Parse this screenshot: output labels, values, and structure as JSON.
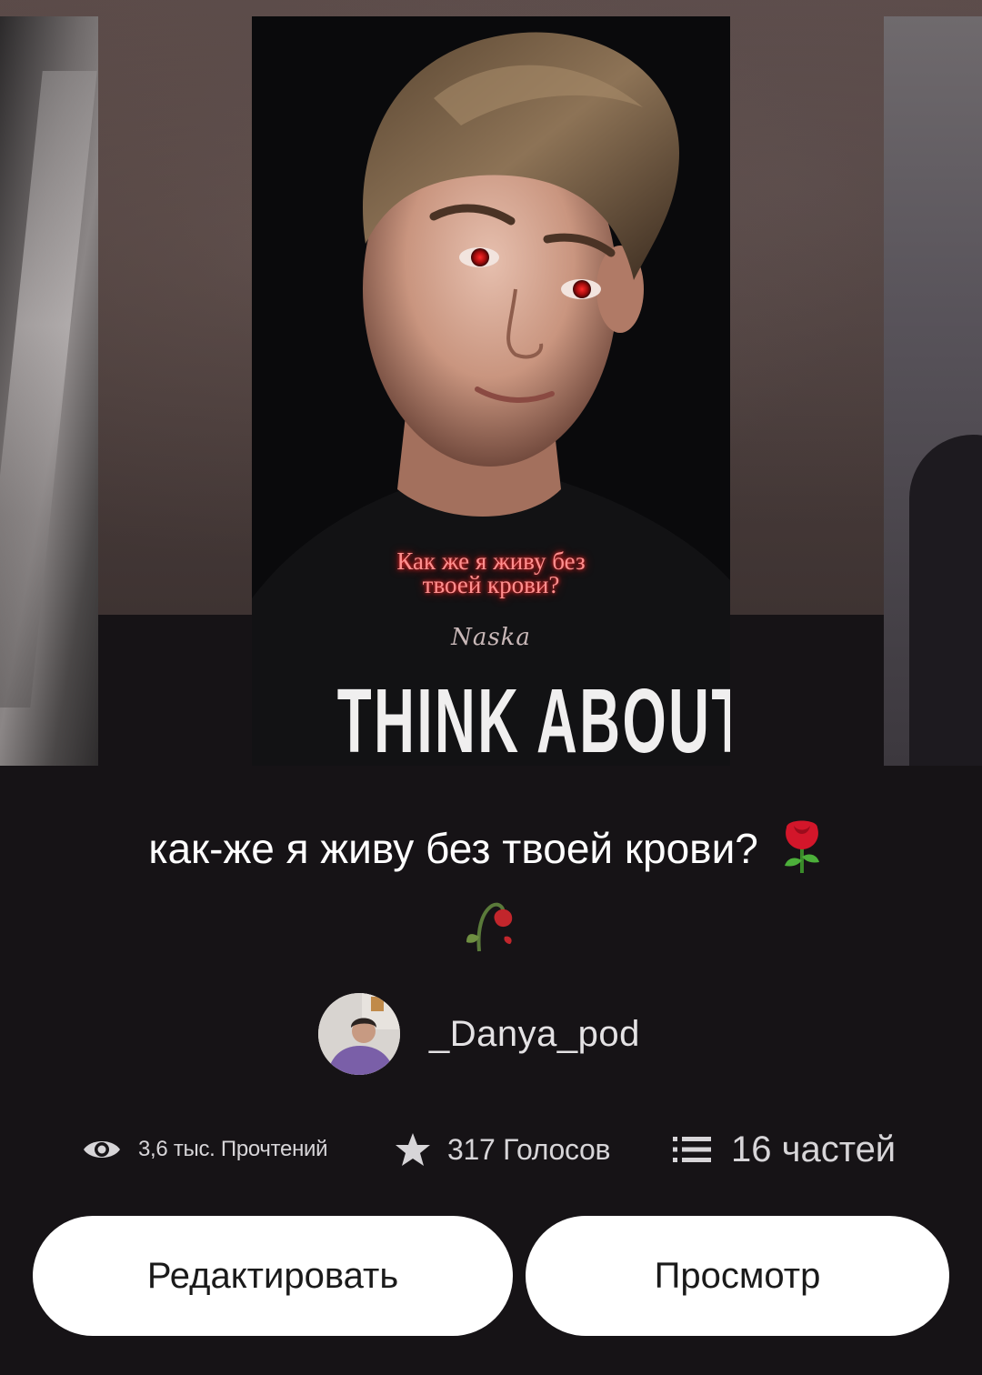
{
  "cover": {
    "quote_line1": "Как же я живу без",
    "quote_line2": "твоей крови?",
    "signature": "Naska",
    "shirt_text": "THINK ABOUT IT"
  },
  "story": {
    "title": "как-же я живу без твоей крови?",
    "title_emojis": [
      "rose-icon",
      "wilted-flower-icon"
    ]
  },
  "author": {
    "name": "_Danya_pod"
  },
  "stats": {
    "reads": "3,6 тыс. Прочтений",
    "votes": "317 Голосов",
    "parts": "16 частей",
    "icons": [
      "eye-icon",
      "star-icon",
      "list-icon"
    ]
  },
  "actions": {
    "edit_label": "Редактировать",
    "view_label": "Просмотр"
  },
  "colors": {
    "background": "#161316",
    "button_bg": "#ffffff",
    "text_primary": "#ffffff",
    "text_secondary": "#d7d5d8",
    "cover_quote": "#ff8f8f"
  }
}
